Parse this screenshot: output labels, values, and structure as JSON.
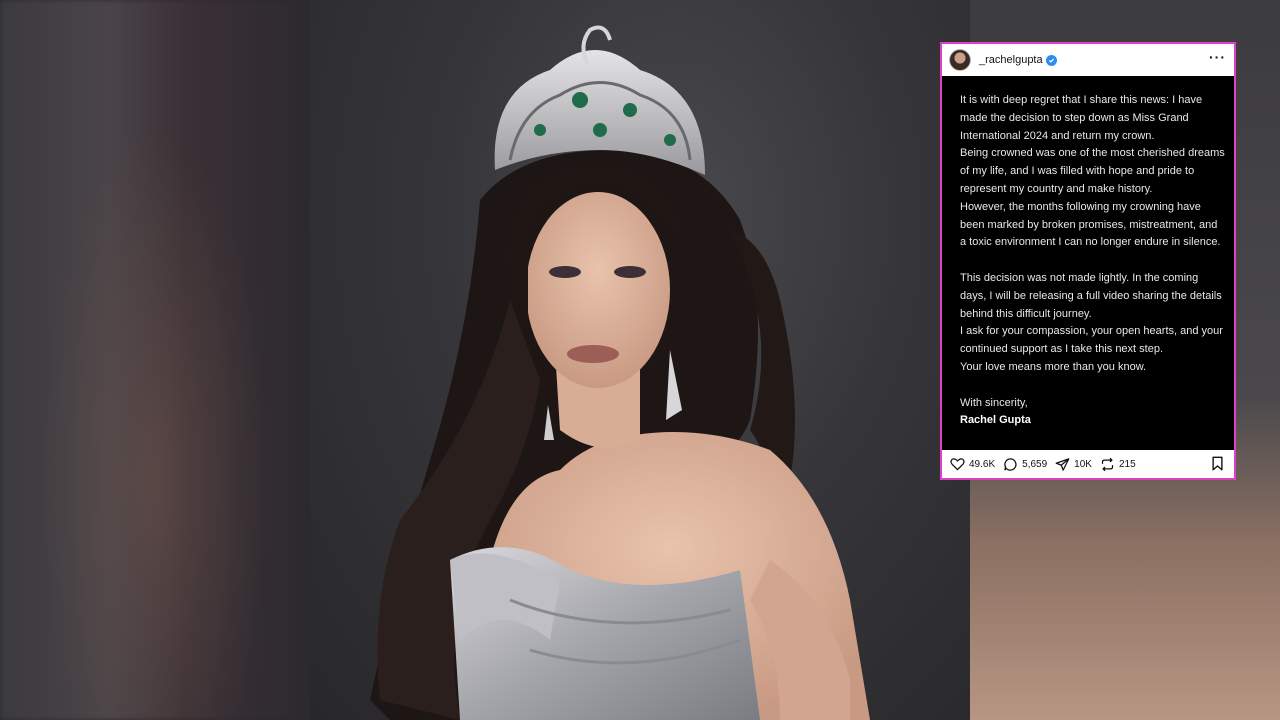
{
  "post": {
    "username": "_rachelgupta",
    "paragraph1": [
      "It is with deep regret that I share this news: I have made the decision to step down as Miss Grand International 2024 and return my crown.",
      "Being crowned was one of the most cherished dreams of my life, and I was filled with hope and pride to represent my country and make history.",
      "However, the months following my crowning have been marked by broken promises, mistreatment, and a toxic environment I can no longer endure in silence."
    ],
    "paragraph2": [
      "This decision was not made lightly. In the coming days, I will be releasing a full video sharing the details behind this difficult journey.",
      "I ask for your compassion, your open hearts, and your continued support as I take this next step.",
      "Your love means more than you know."
    ],
    "closing": "With sincerity,",
    "signature": "Rachel Gupta",
    "stats": {
      "likes": "49.6K",
      "comments": "5,659",
      "shares": "10K",
      "reposts": "215"
    }
  },
  "icons": {
    "like": "heart-icon",
    "comment": "comment-icon",
    "share": "send-icon",
    "repost": "repost-icon",
    "save": "bookmark-icon",
    "more": "more-icon",
    "verified": "verified-icon"
  },
  "colors": {
    "post_border": "#e040c8",
    "verified": "#2f8bf0"
  }
}
